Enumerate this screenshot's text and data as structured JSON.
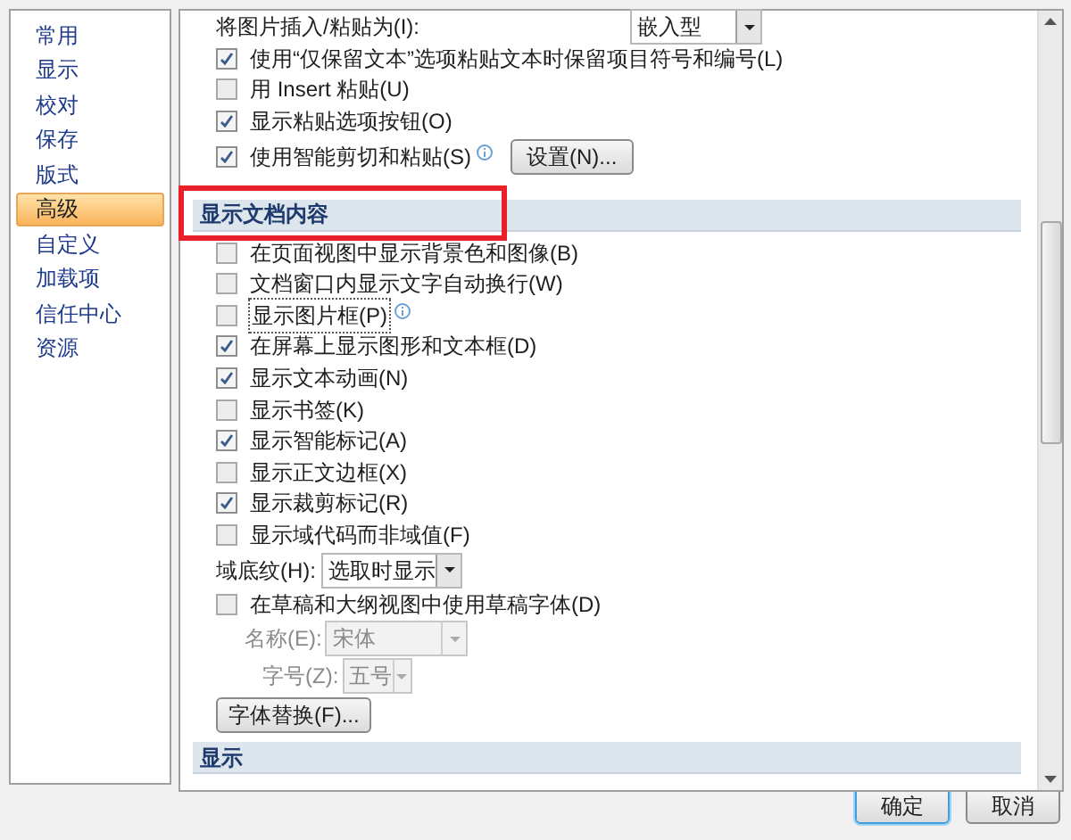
{
  "sidebar": {
    "items": [
      {
        "label": "常用",
        "selected": false
      },
      {
        "label": "显示",
        "selected": false
      },
      {
        "label": "校对",
        "selected": false
      },
      {
        "label": "保存",
        "selected": false
      },
      {
        "label": "版式",
        "selected": false
      },
      {
        "label": "高级",
        "selected": true
      },
      {
        "label": "自定义",
        "selected": false
      },
      {
        "label": "加载项",
        "selected": false
      },
      {
        "label": "信任中心",
        "selected": false
      },
      {
        "label": "资源",
        "selected": false
      }
    ]
  },
  "content": [
    {
      "kind": "dropdown",
      "label": "将图片插入/粘贴为(I):",
      "value": "嵌入型"
    },
    {
      "kind": "checkbox",
      "label": "使用“仅保留文本”选项粘贴文本时保留项目符号和编号(L)",
      "checked": true
    },
    {
      "kind": "checkbox",
      "label": "用 Insert 粘贴(U)",
      "checked": false
    },
    {
      "kind": "checkbox",
      "label": "显示粘贴选项按钮(O)",
      "checked": true
    },
    {
      "kind": "checkbox",
      "label": "使用智能剪切和粘贴(S)",
      "checked": true,
      "info": true,
      "button": "设置(N)..."
    },
    {
      "kind": "section",
      "title": "显示文档内容",
      "highlighted": true
    },
    {
      "kind": "checkbox",
      "label": "在页面视图中显示背景色和图像(B)",
      "checked": false
    },
    {
      "kind": "checkbox",
      "label": "文档窗口内显示文字自动换行(W)",
      "checked": false
    },
    {
      "kind": "checkbox",
      "label": "显示图片框(P)",
      "checked": false,
      "info": true,
      "focused": true
    },
    {
      "kind": "checkbox",
      "label": "在屏幕上显示图形和文本框(D)",
      "checked": true
    },
    {
      "kind": "checkbox",
      "label": "显示文本动画(N)",
      "checked": true
    },
    {
      "kind": "checkbox",
      "label": "显示书签(K)",
      "checked": false
    },
    {
      "kind": "checkbox",
      "label": "显示智能标记(A)",
      "checked": true
    },
    {
      "kind": "checkbox",
      "label": "显示正文边框(X)",
      "checked": false
    },
    {
      "kind": "checkbox",
      "label": "显示裁剪标记(R)",
      "checked": true
    },
    {
      "kind": "checkbox",
      "label": "显示域代码而非域值(F)",
      "checked": false
    },
    {
      "kind": "dropdown",
      "label": "域底纹(H):",
      "value": "选取时显示"
    },
    {
      "kind": "checkbox",
      "label": "在草稿和大纲视图中使用草稿字体(D)",
      "checked": false
    },
    {
      "kind": "font-name",
      "label": "名称(E):",
      "value": "宋体",
      "disabled": true
    },
    {
      "kind": "font-size",
      "label": "字号(Z):",
      "value": "五号",
      "disabled": true
    },
    {
      "kind": "button",
      "label": "字体替换(F)..."
    },
    {
      "kind": "section",
      "title": "显示",
      "highlighted": false
    }
  ],
  "buttons": [
    {
      "label": "确定",
      "default": true
    },
    {
      "label": "取消",
      "default": false
    }
  ]
}
